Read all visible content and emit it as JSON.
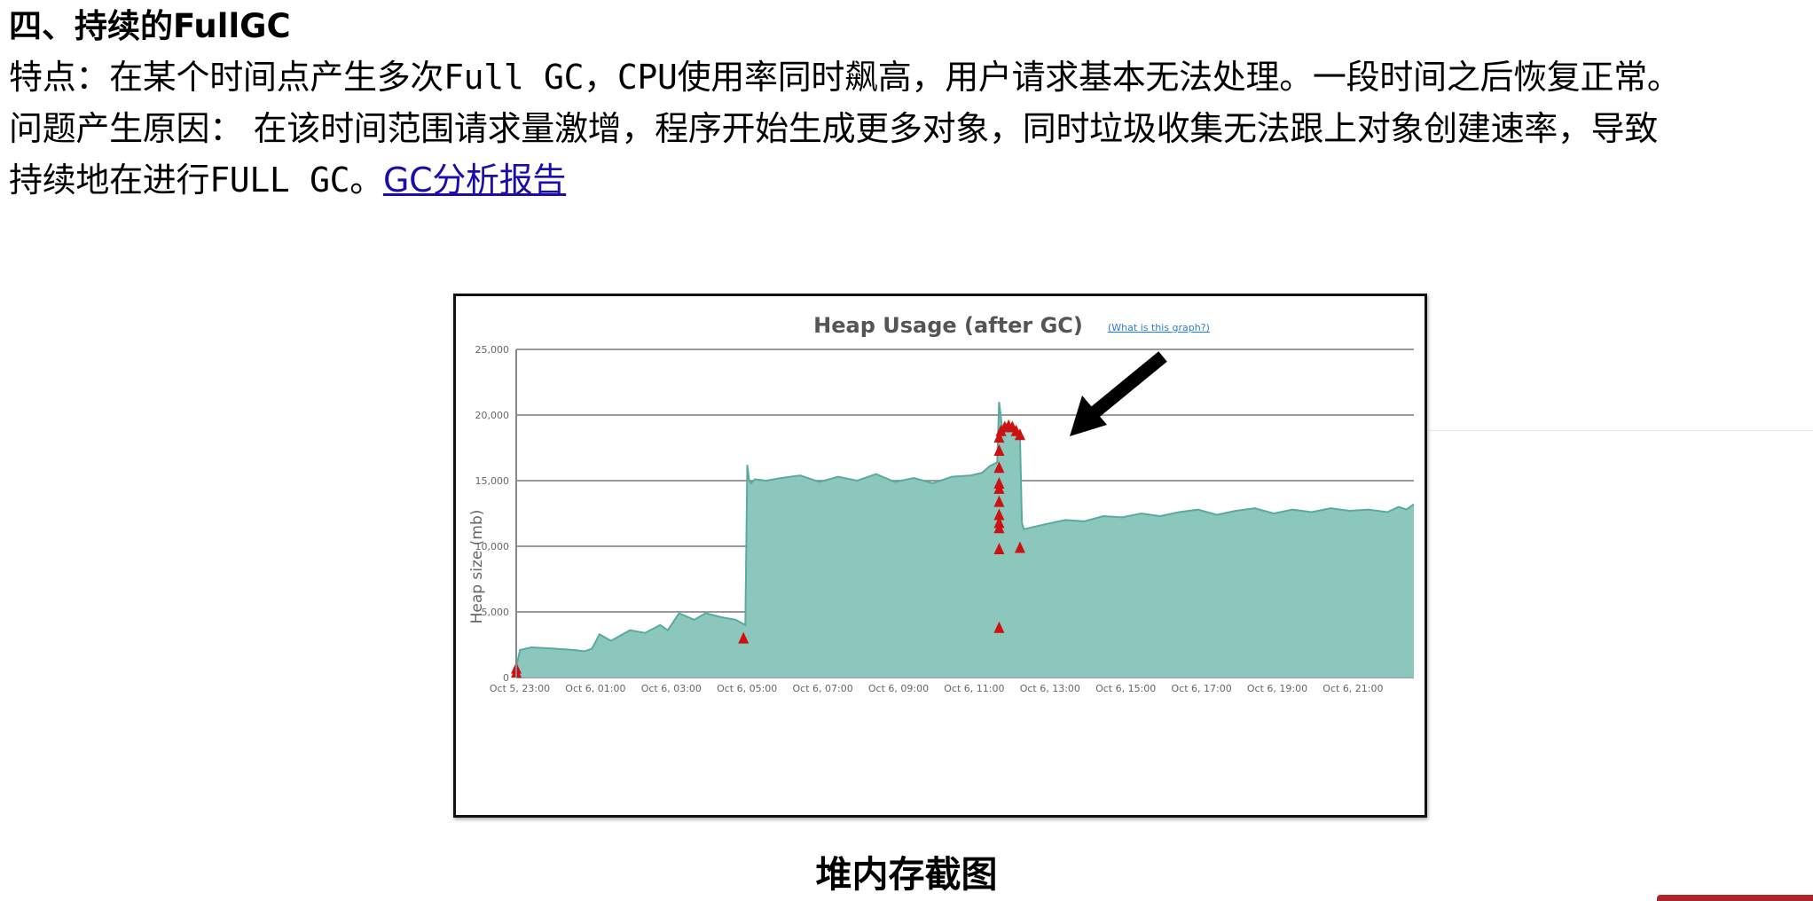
{
  "section_title": "四、持续的FullGC",
  "characteristics": {
    "prefix": "特点：在某个时间点产生多次",
    "term1": "Full GC",
    "mid": "，",
    "term2": "CPU",
    "suffix": "使用率同时飙高，用户请求基本无法处理。一段时间之后恢复正常。"
  },
  "cause": {
    "line1": "问题产生原因：  在该时间范围请求量激增，程序开始生成更多对象，同时垃圾收集无法跟上对象创建速率，导致",
    "line2_prefix": "持续地在进行",
    "line2_term": "FULL GC",
    "line2_period": "。",
    "link_text": "GC分析报告"
  },
  "caption": "堆内存截图",
  "colors": {
    "area": "#8cc7be",
    "area_line": "#5aaa9e",
    "marker": "#cc1111",
    "arrow": "#000000",
    "link": "#1a0dab"
  },
  "chart_data": {
    "type": "area",
    "title": "Heap Usage (after GC)",
    "title_link": "(What is this graph?)",
    "ylabel": "Heap size (mb)",
    "xlabel": "",
    "ylim": [
      0,
      25000
    ],
    "yticks": [
      "0",
      "5,000",
      "10,000",
      "15,000",
      "20,000",
      "25,000"
    ],
    "ytick_values": [
      0,
      5000,
      10000,
      15000,
      20000,
      25000
    ],
    "xlim": [
      -1,
      22.7
    ],
    "xticks": [
      "Oct 5, 23:00",
      "Oct 6, 01:00",
      "Oct 6, 03:00",
      "Oct 6, 05:00",
      "Oct 6, 07:00",
      "Oct 6, 09:00",
      "Oct 6, 11:00",
      "Oct 6, 13:00",
      "Oct 6, 15:00",
      "Oct 6, 17:00",
      "Oct 6, 19:00",
      "Oct 6, 21:00"
    ],
    "xtick_values": [
      -1,
      1,
      3,
      5,
      7,
      9,
      11,
      13,
      15,
      17,
      19,
      21
    ],
    "grid": true,
    "series": [
      {
        "x": [
          -1.0,
          -0.9,
          -0.6,
          0.0,
          0.5,
          0.8,
          1.0,
          1.2,
          1.5,
          2.0,
          2.4,
          2.8,
          3.0,
          3.3,
          3.7,
          4.0,
          4.4,
          4.8,
          5.05,
          5.1,
          5.15,
          5.2,
          5.3,
          5.6,
          6.0,
          6.5,
          7.0,
          7.5,
          8.0,
          8.5,
          9.0,
          9.5,
          10.0,
          10.5,
          11.0,
          11.3,
          11.5,
          11.7,
          11.75,
          11.85,
          12.0,
          12.2,
          12.3,
          12.35,
          12.4,
          12.7,
          13.0,
          13.5,
          14.0,
          14.5,
          15.0,
          15.5,
          16.0,
          16.5,
          17.0,
          17.5,
          18.0,
          18.5,
          19.0,
          19.5,
          20.0,
          20.5,
          21.0,
          21.5,
          22.0,
          22.3,
          22.5,
          22.7
        ],
        "y": [
          800,
          2100,
          2300,
          2200,
          2100,
          2000,
          2200,
          3300,
          2800,
          3600,
          3400,
          4000,
          3600,
          4900,
          4400,
          4900,
          4600,
          4400,
          4000,
          16200,
          15000,
          14800,
          15100,
          15000,
          15200,
          15400,
          14900,
          15300,
          15000,
          15500,
          14900,
          15200,
          14800,
          15300,
          15400,
          15600,
          16100,
          16400,
          21000,
          18500,
          19200,
          19000,
          18500,
          11800,
          11300,
          11500,
          11700,
          12000,
          11900,
          12300,
          12200,
          12500,
          12300,
          12600,
          12800,
          12400,
          12700,
          12900,
          12500,
          12800,
          12600,
          12900,
          12700,
          12800,
          12600,
          13000,
          12800,
          13200
        ]
      }
    ],
    "fullgc_markers": {
      "x": [
        -1.0,
        -1.0,
        5.0,
        11.75,
        11.75,
        11.75,
        11.75,
        11.75,
        11.75,
        11.75,
        11.75,
        11.75,
        11.75,
        11.75,
        11.8,
        11.9,
        12.0,
        12.1,
        12.2,
        12.3,
        12.3
      ],
      "y": [
        700,
        400,
        3000,
        3800,
        9800,
        11400,
        11800,
        12400,
        13400,
        14400,
        14800,
        16000,
        17300,
        18300,
        18800,
        19100,
        19200,
        19100,
        18800,
        18500,
        9900
      ]
    }
  }
}
